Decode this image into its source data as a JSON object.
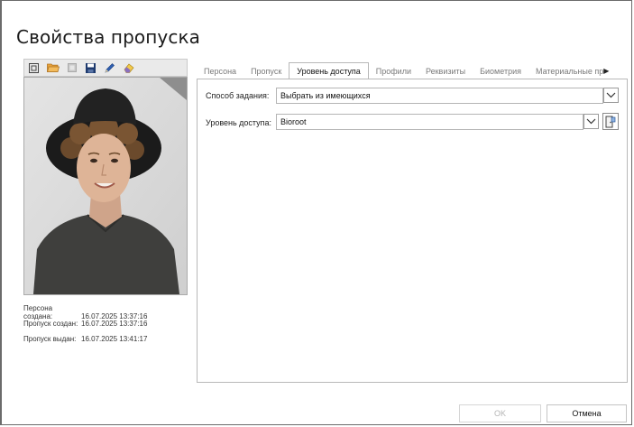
{
  "dialog": {
    "title": "Свойства пропуска"
  },
  "toolbar": {
    "icons": [
      "scan-icon",
      "folder-open-icon",
      "clear-icon",
      "save-icon",
      "pen-icon",
      "eraser-icon"
    ]
  },
  "meta": {
    "person_created_label": "Персона создана:",
    "person_created_value": "16.07.2025 13:37:16",
    "pass_created_label": "Пропуск создан:",
    "pass_created_value": "16.07.2025 13:37:16",
    "pass_issued_label": "Пропуск выдан:",
    "pass_issued_value": "16.07.2025 13:41:17"
  },
  "tabs": [
    {
      "label": "Персона",
      "active": false
    },
    {
      "label": "Пропуск",
      "active": false
    },
    {
      "label": "Уровень доступа",
      "active": true
    },
    {
      "label": "Профили",
      "active": false
    },
    {
      "label": "Реквизиты",
      "active": false
    },
    {
      "label": "Биометрия",
      "active": false
    },
    {
      "label": "Материальные пр",
      "active": false
    }
  ],
  "form": {
    "method_label": "Способ задания:",
    "method_value": "Выбрать из имеющихся",
    "level_label": "Уровень доступа:",
    "level_value": "Bioroot"
  },
  "buttons": {
    "ok": "OK",
    "cancel": "Отмена"
  },
  "colors": {
    "accent_orange": "#e8a23a",
    "frame": "#6b6b6b",
    "toolbar_bg": "#eaeaea"
  }
}
